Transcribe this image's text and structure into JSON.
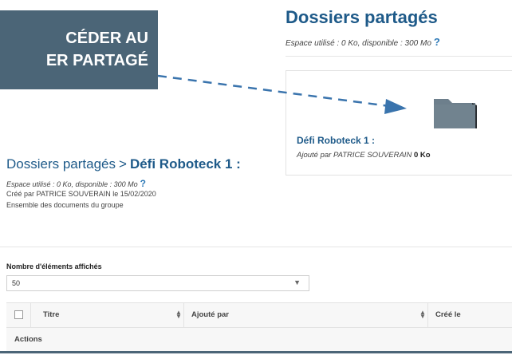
{
  "callout": {
    "line1": "CÉDER AU",
    "line2": "ER PARTAGÉ"
  },
  "top": {
    "title": "Dossiers partagés",
    "usage": "Espace utilisé : 0 Ko, disponible : 300 Mo",
    "help": "?"
  },
  "card": {
    "title": "Défi Roboteck 1 :",
    "added_by": "Ajouté par PATRICE SOUVERAIN",
    "size": "0 Ko"
  },
  "breadcrumb": {
    "parent": "Dossiers partagés",
    "separator": ">",
    "current": "Défi Roboteck 1 :"
  },
  "details": {
    "usage": "Espace utilisé : 0 Ko, disponible : 300 Mo",
    "help": "?",
    "created": "Créé par PATRICE SOUVERAIN le 15/02/2020",
    "description": "Ensemble des documents du groupe"
  },
  "list": {
    "count_label": "Nombre d'éléments affichés",
    "count_value": "50",
    "columns": [
      "Titre",
      "Ajouté par",
      "Créé le"
    ],
    "actions_label": "Actions"
  },
  "colors": {
    "accent": "#1e5a89",
    "callout_bg": "#4b6577",
    "help": "#2f7ab7",
    "folder": "#6d7f8c"
  },
  "icons": {
    "folder": "folder-icon",
    "help": "question-mark-icon",
    "dropdown": "chevron-down-icon",
    "sort": "sort-icon",
    "checkbox": "checkbox-icon"
  }
}
